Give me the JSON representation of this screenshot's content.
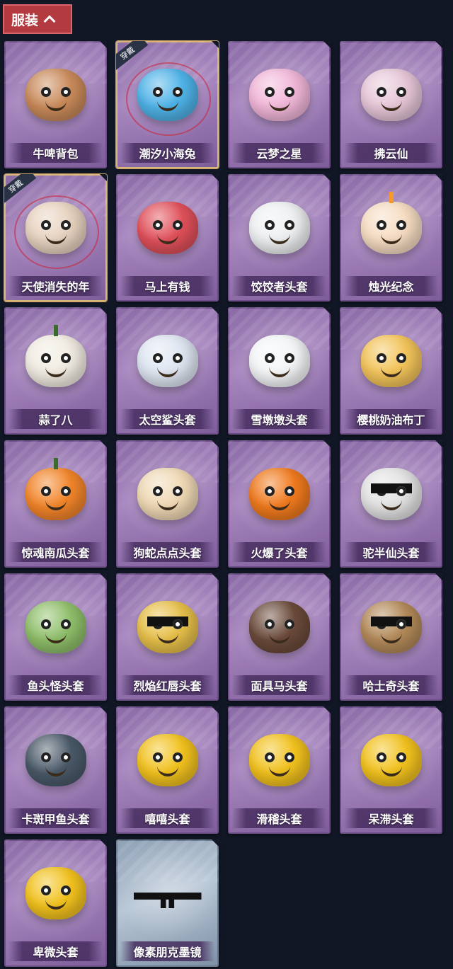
{
  "header": {
    "title": "服装"
  },
  "items": [
    {
      "name": "牛啤背包",
      "equipped": false,
      "icon": "cow-beer-backpack",
      "color": "#c98a5a"
    },
    {
      "name": "潮汐小海兔",
      "equipped": true,
      "badge": "穿戴",
      "icon": "blue-sea-bunny",
      "color": "#4fb3e8"
    },
    {
      "name": "云梦之星",
      "equipped": false,
      "icon": "unicorn-cloud",
      "color": "#f2b7d9"
    },
    {
      "name": "拂云仙",
      "equipped": false,
      "icon": "fairy-pendant",
      "color": "#e7c7d8"
    },
    {
      "name": "天使消失的年",
      "equipped": true,
      "badge": "穿戴",
      "icon": "angel-doll",
      "color": "#e8d3c0"
    },
    {
      "name": "马上有钱",
      "equipped": false,
      "icon": "red-horse-head",
      "color": "#e0505a"
    },
    {
      "name": "饺饺者头套",
      "equipped": false,
      "icon": "dumpling-head",
      "color": "#eef0f2"
    },
    {
      "name": "烛光纪念",
      "equipped": false,
      "icon": "candle-head",
      "color": "#f6dcc2"
    },
    {
      "name": "蒜了八",
      "equipped": false,
      "icon": "garlic-head",
      "color": "#f1ece2"
    },
    {
      "name": "太空鲨头套",
      "equipped": false,
      "icon": "space-shark-head",
      "color": "#dfe6f2"
    },
    {
      "name": "雪墩墩头套",
      "equipped": false,
      "icon": "snowman-head",
      "color": "#f4f6f8"
    },
    {
      "name": "樱桃奶油布丁",
      "equipped": false,
      "icon": "pudding-head",
      "color": "#f3c45a"
    },
    {
      "name": "惊魂南瓜头套",
      "equipped": false,
      "icon": "pumpkin-head",
      "color": "#f2852a"
    },
    {
      "name": "狗蛇点点头套",
      "equipped": false,
      "icon": "snake-dog-head",
      "color": "#f0d9b5"
    },
    {
      "name": "火爆了头套",
      "equipped": false,
      "icon": "fire-head",
      "color": "#f07a1e"
    },
    {
      "name": "驼半仙头套",
      "equipped": false,
      "icon": "koala-shades-head",
      "color": "#e3e3e3"
    },
    {
      "name": "鱼头怪头套",
      "equipped": false,
      "icon": "fish-monster-head",
      "color": "#8fbf6a"
    },
    {
      "name": "烈焰红唇头套",
      "equipped": false,
      "icon": "yellow-shades-head",
      "color": "#e7c04a"
    },
    {
      "name": "面具马头套",
      "equipped": false,
      "icon": "horse-mask-head",
      "color": "#6a4a3a"
    },
    {
      "name": "哈士奇头套",
      "equipped": false,
      "icon": "husky-shades-head",
      "color": "#b38a5a"
    },
    {
      "name": "卡斑甲鱼头套",
      "equipped": false,
      "icon": "whale-head",
      "color": "#4a5968"
    },
    {
      "name": "嘻嘻头套",
      "equipped": false,
      "icon": "grin-emoji-head",
      "color": "#f2c21e"
    },
    {
      "name": "滑稽头套",
      "equipped": false,
      "icon": "funny-emoji-head",
      "color": "#f2c21e"
    },
    {
      "name": "呆滞头套",
      "equipped": false,
      "icon": "stunned-emoji-head",
      "color": "#f2c21e"
    },
    {
      "name": "卑微头套",
      "equipped": false,
      "icon": "humble-emoji-head",
      "color": "#f2c21e"
    },
    {
      "name": "像素朋克墨镜",
      "equipped": false,
      "special": true,
      "icon": "pixel-sunglasses",
      "color": "#111111"
    }
  ]
}
